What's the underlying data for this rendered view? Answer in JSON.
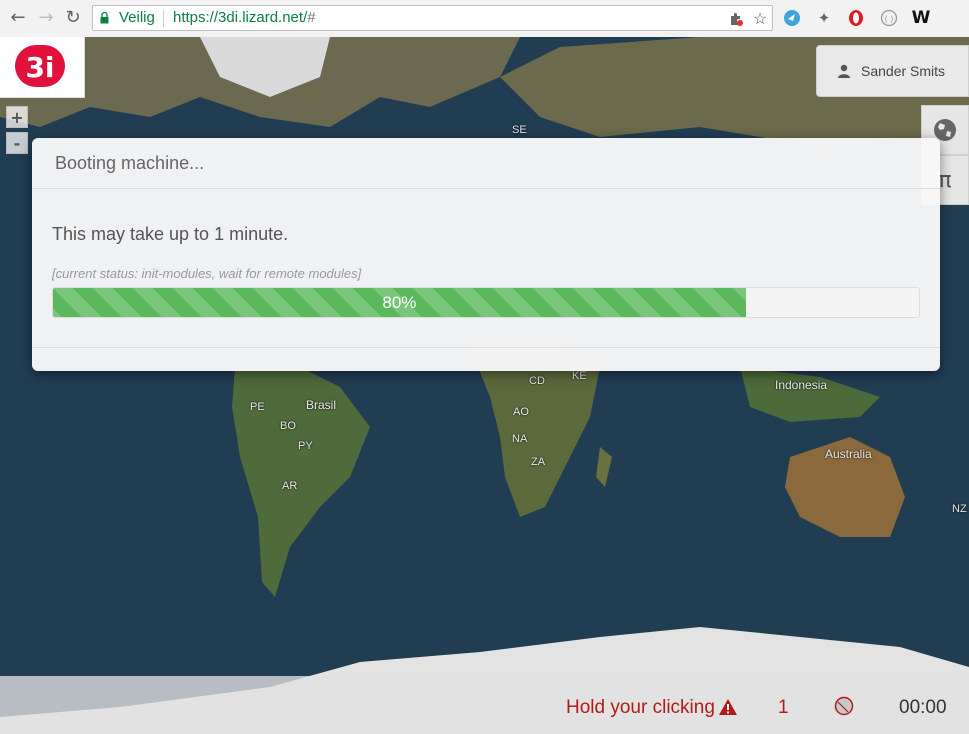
{
  "browser": {
    "back_icon": "arrow-left-icon",
    "forward_icon": "arrow-right-icon",
    "reload_icon": "reload-icon",
    "security_label": "Veilig",
    "url_host": "https://3di.lizard.net/",
    "url_path": "#",
    "extensions": [
      "puzzle-icon",
      "star-icon",
      "bird-extension-icon",
      "pin-extension-icon",
      "opera-extension-icon",
      "code-extension-icon",
      "w-extension-icon"
    ]
  },
  "app": {
    "logo_text": "3i",
    "zoom_in": "+",
    "zoom_out": "-",
    "user_name": "Sander Smits",
    "side_button_glyph": "π"
  },
  "map": {
    "labels": {
      "se": "SE",
      "brasil": "Brasil",
      "pe": "PE",
      "bo": "BO",
      "py": "PY",
      "ar": "AR",
      "cd": "CD",
      "ke": "KE",
      "ao": "AO",
      "na": "NA",
      "za": "ZA",
      "indonesia": "Indonesia",
      "australia": "Australia",
      "nz": "NZ"
    }
  },
  "modal": {
    "title": "Booting machine...",
    "message": "This may take up to 1 minute.",
    "status": "[current status: init-modules, wait for remote modules]",
    "progress_label": "80%",
    "progress_value": 0.8,
    "progress_color": "#5cb85c"
  },
  "statusbar": {
    "hold_text": "Hold your clicking",
    "warning_icon": "warning-icon",
    "count": "1",
    "record_icon": "record-icon",
    "timer": "00:00",
    "alert_color": "#b31b1b"
  }
}
